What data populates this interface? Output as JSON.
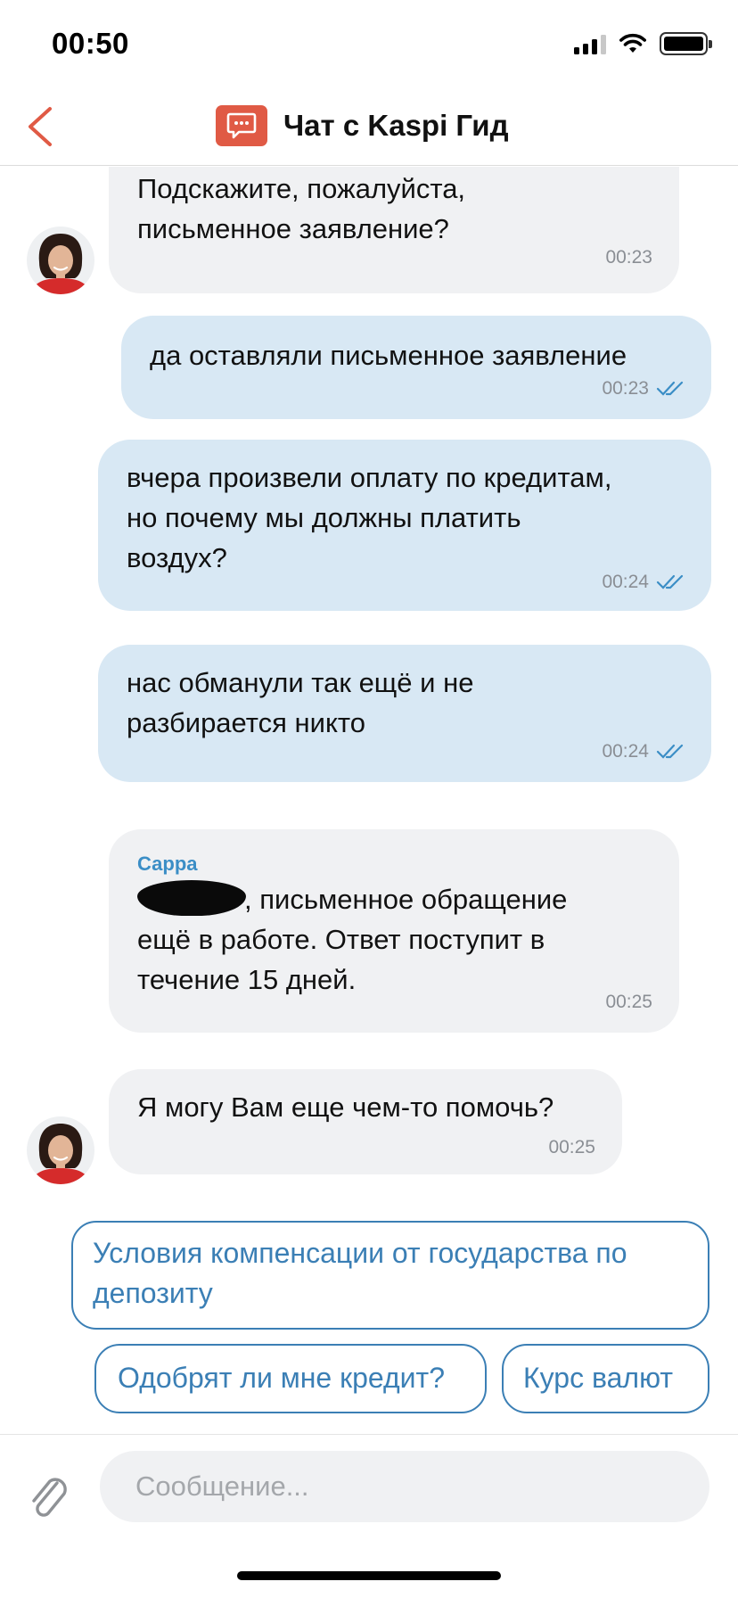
{
  "status_bar": {
    "time": "00:50"
  },
  "header": {
    "title": "Чат с Kaspi Гид"
  },
  "messages": [
    {
      "lines": [
        "Подскажите, пожалуйста,",
        "письменное заявление?"
      ],
      "time": "00:23"
    },
    {
      "lines": [
        "да оставляли письменное заявление"
      ],
      "time": "00:23"
    },
    {
      "lines": [
        "вчера произвели оплату по кредитам,",
        "но почему мы должны платить",
        "воздух?"
      ],
      "time": "00:24"
    },
    {
      "lines": [
        "нас обманули так ещё и не",
        "разбирается никто"
      ],
      "time": "00:24"
    },
    {
      "sender": "Сарра",
      "lines": [
        ", письменное обращение",
        "ещё в работе. Ответ поступит в",
        "течение 15 дней."
      ],
      "time": "00:25"
    },
    {
      "lines": [
        "Я могу Вам еще чем-то помочь?"
      ],
      "time": "00:25"
    }
  ],
  "quick_replies": [
    {
      "lines": [
        "Условия компенсации от государства по",
        "депозиту"
      ]
    },
    {
      "label": "Одобрят ли мне кредит?"
    },
    {
      "label": "Курс валют"
    }
  ],
  "input": {
    "placeholder": "Сообщение..."
  },
  "colors": {
    "accent": "#e05a45",
    "link": "#3b7fb5",
    "outgoing_bubble": "#d8e8f4",
    "incoming_bubble": "#f0f1f3",
    "read_check": "#3b8ec6"
  },
  "icons": [
    "back-chevron-icon",
    "chat-bubble-icon",
    "paperclip-icon",
    "double-check-icon"
  ]
}
